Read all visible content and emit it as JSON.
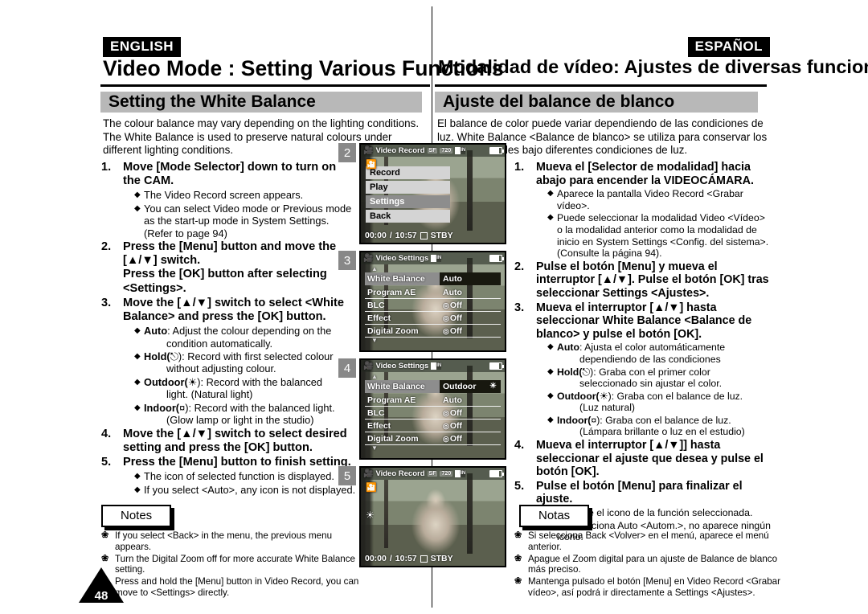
{
  "page": {
    "number": "48",
    "lang_tag_left": "ENGLISH",
    "lang_tag_right": "ESPAÑOL"
  },
  "english": {
    "running_head": "Video Mode : Setting Various Functions",
    "section_title": "Setting the White Balance",
    "intro": "The colour balance may vary depending on the lighting conditions. The White Balance is used to preserve natural colours under different lighting conditions.",
    "steps": [
      {
        "num": "1.",
        "title": "Move [Mode Selector] down to turn on the CAM.",
        "bullets": [
          {
            "text": "The Video Record screen appears."
          },
          {
            "text": "You can select Video mode or Previous mode as the start-up mode in System Settings. (Refer to page 94)"
          }
        ]
      },
      {
        "num": "2.",
        "title": "Press the [Menu] button and move the [▲/▼] switch.\nPress the [OK] button after selecting <Settings>.",
        "bullets": []
      },
      {
        "num": "3.",
        "title": "Move the [▲/▼] switch to select <White Balance> and press the [OK] button.",
        "bullets": [
          {
            "label": "Auto",
            "text": ": Adjust the colour depending on the",
            "cont": "condition automatically."
          },
          {
            "label": "Hold(",
            "icon": "hold",
            "text": "): Record with first selected colour",
            "cont": "without adjusting colour."
          },
          {
            "label": "Outdoor(",
            "icon": "sun",
            "text": "): Record with the balanced",
            "cont": "light. (Natural light)"
          },
          {
            "label": "Indoor(",
            "icon": "bulb",
            "text": "): Record with the balanced light.",
            "cont": "(Glow lamp or light in the studio)"
          }
        ]
      },
      {
        "num": "4.",
        "title": "Move the [▲/▼] switch to select desired setting and press the [OK] button.",
        "bullets": []
      },
      {
        "num": "5.",
        "title": "Press the [Menu] button to finish setting.",
        "bullets": [
          {
            "text": "The icon of selected function is displayed."
          },
          {
            "text": "If you select <Auto>, any icon is not displayed."
          }
        ]
      }
    ],
    "notes_label": "Notes",
    "notes": [
      "If you select <Back> in the menu, the previous menu appears.",
      "Turn the Digital Zoom off for more accurate White Balance setting.",
      "Press and hold the [Menu] button in Video Record, you can move to <Settings> directly."
    ]
  },
  "spanish": {
    "running_head": "Modalidad de vídeo: Ajustes de diversas funciones",
    "section_title": "Ajuste del balance de blanco",
    "intro": "El balance de color puede variar dependiendo de las condiciones de luz. White Balance <Balance de blanco> se utiliza para conservar los colores naturales bajo diferentes condiciones de luz.",
    "steps": [
      {
        "num": "1.",
        "title": "Mueva el [Selector de modalidad] hacia abajo para encender la VIDEOCÁMARA.",
        "bullets": [
          {
            "text": "Aparece la pantalla Video Record <Grabar vídeo>."
          },
          {
            "text": "Puede seleccionar la modalidad Video <Vídeo> o la modalidad anterior como la modalidad de inicio en System Settings <Config. del sistema>. (Consulte la página 94)."
          }
        ]
      },
      {
        "num": "2.",
        "title": "Pulse el botón [Menu] y mueva el interruptor [▲/▼]. Pulse el botón [OK] tras seleccionar Settings <Ajustes>.",
        "bullets": []
      },
      {
        "num": "3.",
        "title": "Mueva el interruptor [▲/▼] hasta seleccionar White Balance <Balance de blanco> y pulse el botón [OK].",
        "bullets": [
          {
            "label": "Auto",
            "text": ": Ajusta el color automáticamente",
            "cont": "dependiendo de las condiciones"
          },
          {
            "label": "Hold(",
            "icon": "hold",
            "text": "): Graba con el primer color",
            "cont": "seleccionado sin ajustar el color."
          },
          {
            "label": "Outdoor(",
            "icon": "sun",
            "text": "): Graba con el balance de luz.",
            "cont": "(Luz natural)"
          },
          {
            "label": "Indoor(",
            "icon": "bulb",
            "text": "): Graba con el balance de luz.",
            "cont": "(Lámpara brillante o luz en el estudio)"
          }
        ]
      },
      {
        "num": "4.",
        "title": "Mueva el interruptor [▲/▼]] hasta seleccionar el ajuste que desea y pulse el botón [OK].",
        "bullets": []
      },
      {
        "num": "5.",
        "title": "Pulse el botón [Menu] para finalizar el ajuste.",
        "bullets": [
          {
            "text": "Aparece el icono de la función seleccionada."
          },
          {
            "text": "Si selecciona Auto <Autom.>, no aparece ningún icono."
          }
        ]
      }
    ],
    "notes_label": "Notas",
    "notes": [
      "Si selecciona Back <Volver> en el menú, aparece el menú anterior.",
      "Apague el Zoom digital para un ajuste de Balance de blanco más preciso.",
      "Mantenga pulsado el botón [Menu] en Video Record <Grabar vídeo>, así podrá ir directamente a Settings <Ajustes>."
    ]
  },
  "screens": [
    {
      "badge": "2",
      "type": "menu",
      "topbar": {
        "title": "Video Record",
        "quality": "SF",
        "resolution": "720",
        "card": "IN"
      },
      "menu_items": [
        {
          "label": "Record",
          "selected": false
        },
        {
          "label": "Play",
          "selected": false
        },
        {
          "label": "Settings",
          "selected": true
        },
        {
          "label": "Back",
          "selected": false
        }
      ],
      "bottombar": {
        "elapsed": "00:00",
        "separator": "/",
        "remaining": "10:57",
        "status": "STBY"
      }
    },
    {
      "badge": "3",
      "type": "settings",
      "topbar": {
        "title": "Video Settings",
        "card": "IN"
      },
      "rows": [
        {
          "label": "White Balance",
          "value": "Auto",
          "selected": true,
          "value_icon": ""
        },
        {
          "label": "Program AE",
          "value": "Auto",
          "selected": false,
          "value_icon": ""
        },
        {
          "label": "BLC",
          "value": "Off",
          "selected": false,
          "value_icon": "circle"
        },
        {
          "label": "Effect",
          "value": "Off",
          "selected": false,
          "value_icon": "circle"
        },
        {
          "label": "Digital Zoom",
          "value": "Off",
          "selected": false,
          "value_icon": "circle"
        }
      ]
    },
    {
      "badge": "4",
      "type": "settings",
      "topbar": {
        "title": "Video Settings",
        "card": "IN"
      },
      "rows": [
        {
          "label": "White Balance",
          "value": "Outdoor",
          "selected": true,
          "value_icon": "sun"
        },
        {
          "label": "Program AE",
          "value": "Auto",
          "selected": false,
          "value_icon": ""
        },
        {
          "label": "BLC",
          "value": "Off",
          "selected": false,
          "value_icon": "circle"
        },
        {
          "label": "Effect",
          "value": "Off",
          "selected": false,
          "value_icon": "circle"
        },
        {
          "label": "Digital Zoom",
          "value": "Off",
          "selected": false,
          "value_icon": "circle"
        }
      ]
    },
    {
      "badge": "5",
      "type": "record",
      "topbar": {
        "title": "Video Record",
        "quality": "SF",
        "resolution": "720",
        "card": "IN"
      },
      "bottombar": {
        "elapsed": "00:00",
        "separator": "/",
        "remaining": "10:57",
        "status": "STBY"
      }
    }
  ]
}
